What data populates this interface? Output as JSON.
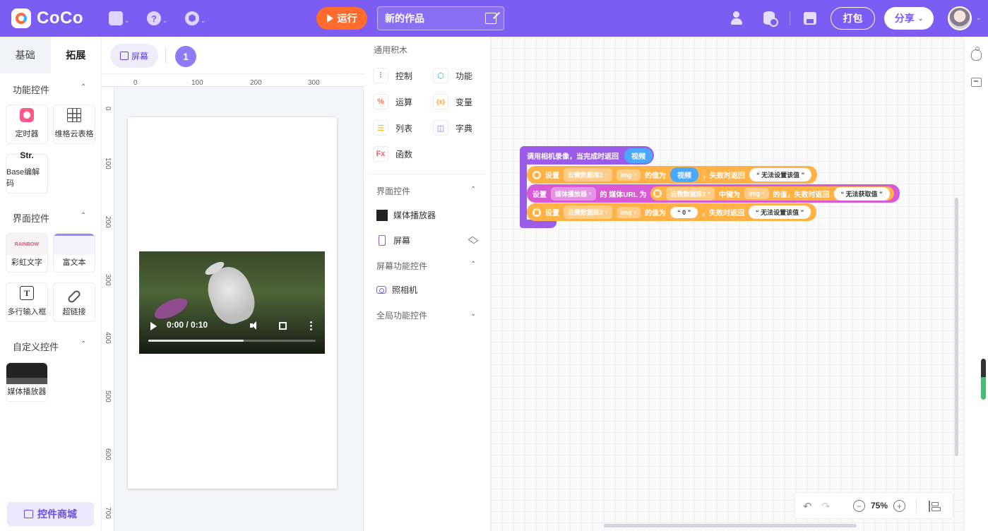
{
  "app": {
    "logo_text": "CoCo",
    "run_label": "运行",
    "project_title": "新的作品",
    "pack_label": "打包",
    "share_label": "分享",
    "colors": {
      "brand": "#7c5cf2",
      "run": "#ff6b2c"
    }
  },
  "left_panel": {
    "tabs": [
      {
        "label": "基础"
      },
      {
        "label": "拓展"
      }
    ],
    "sections": [
      {
        "title": "功能控件",
        "items": [
          {
            "label": "定时器",
            "icon": "timer-icon"
          },
          {
            "label": "维格云表格",
            "icon": "grid-icon"
          },
          {
            "label": "Base编解码",
            "icon_text": "Str."
          }
        ]
      },
      {
        "title": "界面控件",
        "items": [
          {
            "label": "彩虹文字",
            "icon": "rainbow-thumb",
            "thumb_text": "RAINBOW"
          },
          {
            "label": "富文本",
            "icon": "richtext-thumb"
          },
          {
            "label": "多行输入框",
            "icon": "textarea-icon",
            "icon_text": "T"
          },
          {
            "label": "超链接",
            "icon": "link-icon"
          }
        ]
      },
      {
        "title": "自定义控件",
        "items": [
          {
            "label": "媒体播放器",
            "icon": "media-thumb"
          }
        ]
      }
    ],
    "store_label": "控件商城"
  },
  "stage": {
    "screen_label": "屏幕",
    "page_number": "1",
    "ruler_x": [
      "0",
      "100",
      "200",
      "300"
    ],
    "ruler_y": [
      "0",
      "100",
      "200",
      "300",
      "400",
      "500",
      "600",
      "700"
    ],
    "video": {
      "time": "0:00 / 0:10",
      "progress": 0.57
    }
  },
  "palette": {
    "title": "通用积木",
    "categories": [
      {
        "label": "控制",
        "glyph": "⫶",
        "color": "#2f9bd8"
      },
      {
        "label": "功能",
        "glyph": "⬡",
        "color": "#1bb3b3"
      },
      {
        "label": "运算",
        "glyph": "%",
        "color": "#ff7a45"
      },
      {
        "label": "变量",
        "glyph": "{x}",
        "color": "#ffa51f"
      },
      {
        "label": "列表",
        "glyph": "☰",
        "color": "#ffb800"
      },
      {
        "label": "字典",
        "glyph": "◫",
        "color": "#8a6cf2"
      },
      {
        "label": "函数",
        "glyph": "Fx",
        "color": "#ff5f5f"
      }
    ],
    "ui_section": "界面控件",
    "ui_items": [
      {
        "label": "媒体播放器"
      },
      {
        "label": "屏幕"
      }
    ],
    "screen_section": "屏幕功能控件",
    "screen_items": [
      {
        "label": "照相机"
      }
    ],
    "global_section": "全局功能控件"
  },
  "blocks": {
    "hat": {
      "text": "调用相机录像，当完成时返回",
      "param": "视频"
    },
    "b1": {
      "set": "设置",
      "db": "云微数据库2",
      "key": "img",
      "value_of": "的值为",
      "param": "视频",
      "fail": "，失败时返回",
      "msg": "“ 无法设置该值 ”"
    },
    "b2": {
      "set": "设置",
      "player": "媒体播放器",
      "url_label": "的 媒体URL 为",
      "db": "云微数据库2",
      "key_label": "中键为",
      "key": "img",
      "value_fail": "的值，失败时返回",
      "msg": "“ 无法获取值 ”"
    },
    "b3": {
      "set": "设置",
      "db": "云微数据库2",
      "key": "img",
      "value_of": "的值为",
      "val": "“ 0 ”",
      "fail": "，失败时返回",
      "msg": "“ 无法设置该值 ”"
    }
  },
  "zoom": {
    "value": "75%"
  }
}
